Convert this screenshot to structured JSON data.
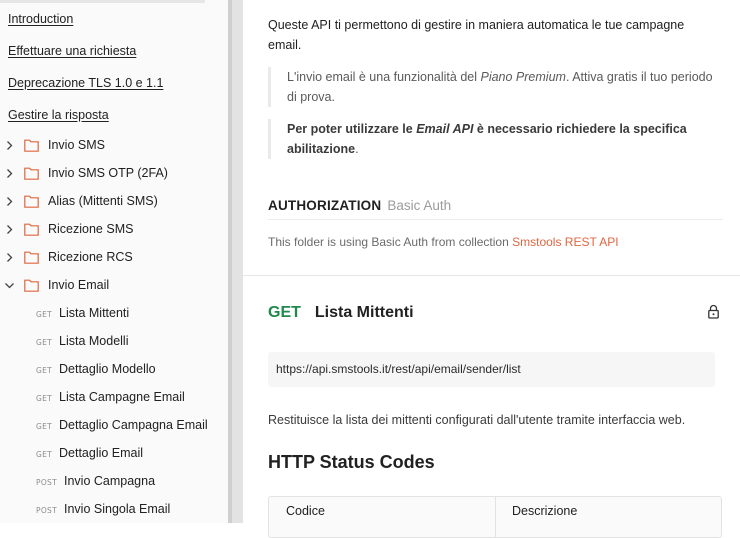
{
  "sidebar": {
    "doc_links": [
      "Introduction",
      "Effettuare una richiesta",
      "Deprecazione TLS 1.0 e 1.1",
      "Gestire la risposta"
    ],
    "folders": [
      {
        "label": "Invio SMS",
        "expanded": false
      },
      {
        "label": "Invio SMS OTP (2FA)",
        "expanded": false
      },
      {
        "label": "Alias (Mittenti SMS)",
        "expanded": false
      },
      {
        "label": "Ricezione SMS",
        "expanded": false
      },
      {
        "label": "Ricezione RCS",
        "expanded": false
      },
      {
        "label": "Invio Email",
        "expanded": true
      }
    ],
    "requests": [
      {
        "method": "GET",
        "label": "Lista Mittenti"
      },
      {
        "method": "GET",
        "label": "Lista Modelli"
      },
      {
        "method": "GET",
        "label": "Dettaglio Modello"
      },
      {
        "method": "GET",
        "label": "Lista Campagne Email"
      },
      {
        "method": "GET",
        "label": "Dettaglio Campagna Email"
      },
      {
        "method": "GET",
        "label": "Dettaglio Email"
      },
      {
        "method": "POST",
        "label": "Invio Campagna"
      },
      {
        "method": "POST",
        "label": "Invio Singola Email"
      }
    ]
  },
  "main": {
    "intro_line1": "Queste API ti permettono di gestire in maniera automatica le tue campagne",
    "intro_line2": "email.",
    "note1_a": "L'invio email è una funzionalità del ",
    "note1_em": "Piano Premium",
    "note1_b": ". Attiva gratis il tuo periodo",
    "note1_c": "di prova.",
    "note2_a": "Per poter utilizzare le ",
    "note2_em": "Email API",
    "note2_b": " è necessario richiedere la specifica",
    "note2_c": "abilitazione",
    "note2_d": ".",
    "auth_title": "AUTHORIZATION",
    "auth_type": "Basic Auth",
    "auth_desc": "This folder is using Basic Auth from collection ",
    "auth_collection": "Smstools REST API",
    "endpoint_method": "GET",
    "endpoint_name": "Lista Mittenti",
    "endpoint_url": "https://api.smstools.it/rest/api/email/sender/list",
    "endpoint_desc": "Restituisce la lista dei mittenti configurati dall'utente tramite interfaccia web.",
    "status_heading": "HTTP Status Codes",
    "table_headers": [
      "Codice",
      "Descrizione"
    ]
  },
  "colors": {
    "accent_link": "#e06640",
    "folder_icon": "#e06640",
    "get_method": "#1f8a4b",
    "sidebar_bg": "#fafafa"
  }
}
